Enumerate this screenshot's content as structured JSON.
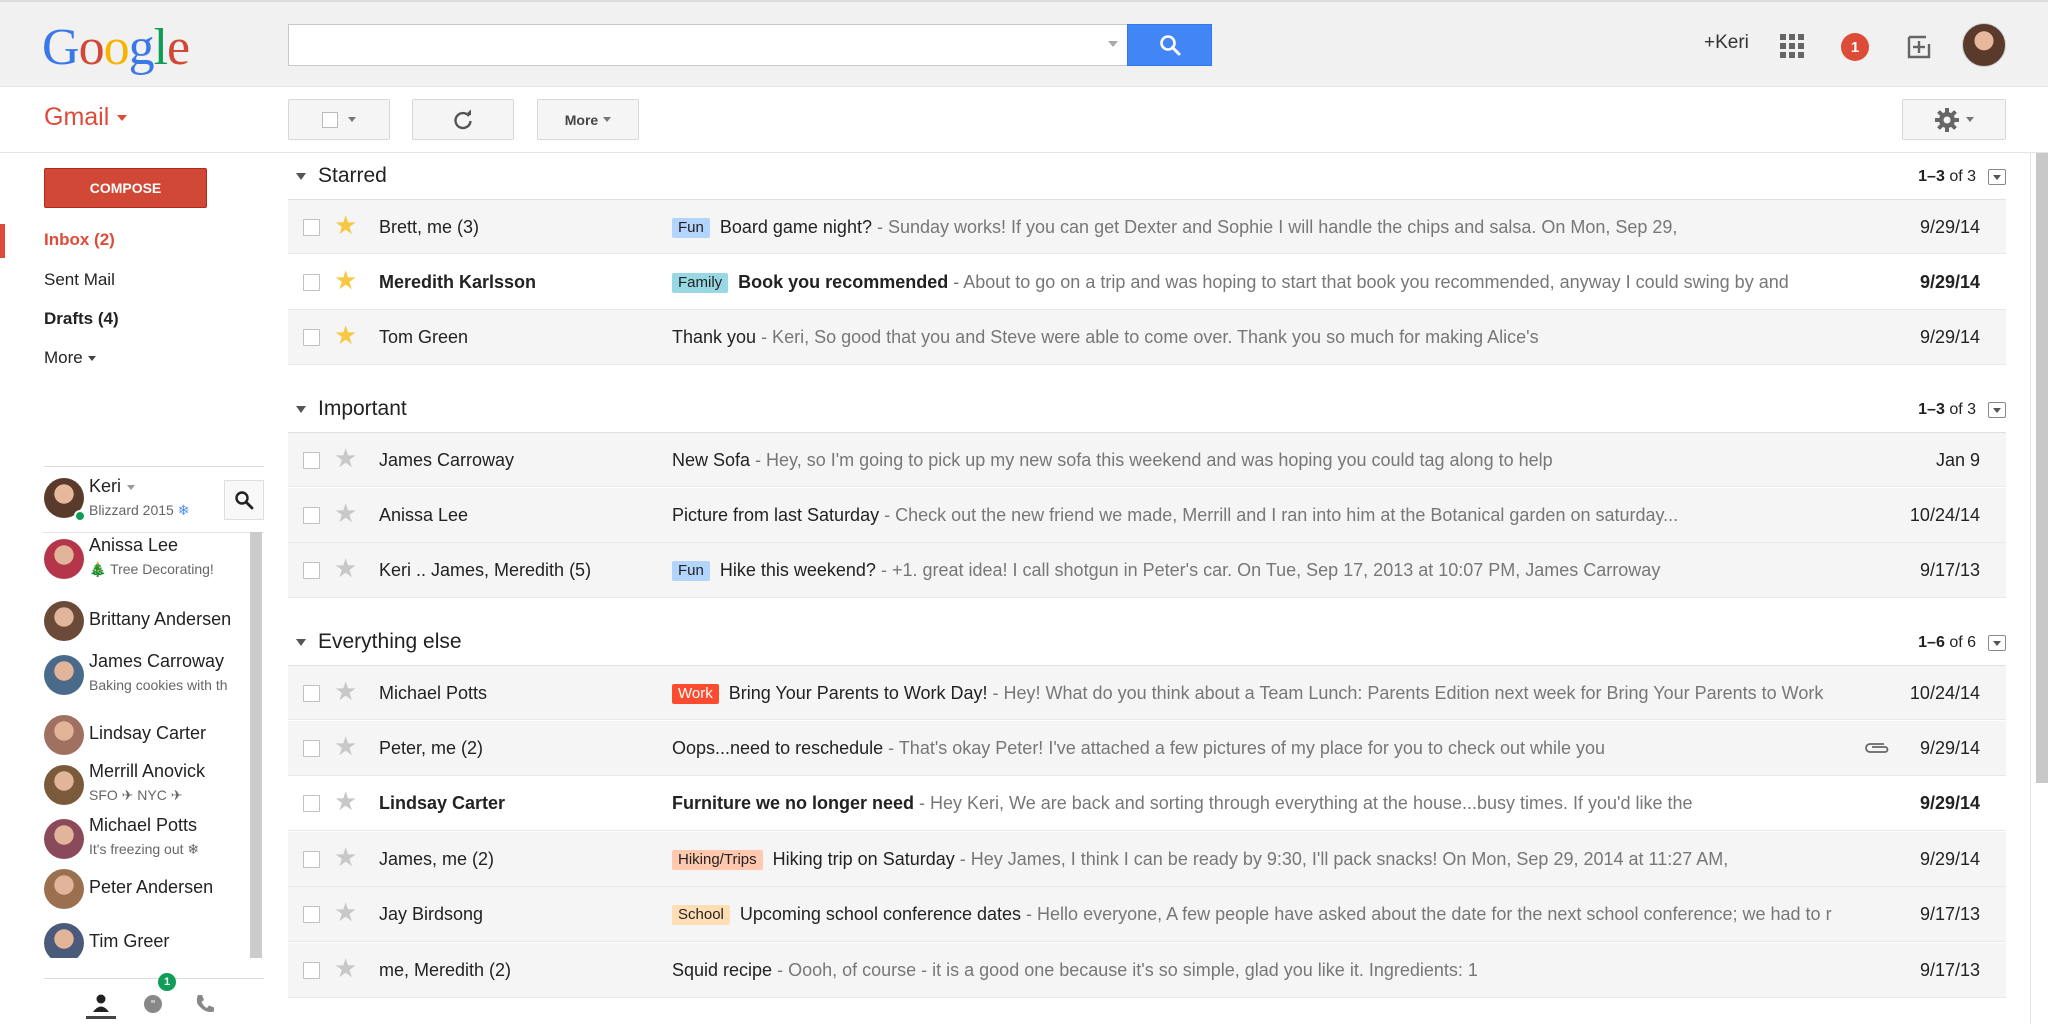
{
  "header": {
    "logo_letters": [
      {
        "char": "G",
        "color": "#3b78e7"
      },
      {
        "char": "o",
        "color": "#d14836"
      },
      {
        "char": "o",
        "color": "#f4b400"
      },
      {
        "char": "g",
        "color": "#3b78e7"
      },
      {
        "char": "l",
        "color": "#0f9d58"
      },
      {
        "char": "e",
        "color": "#d14836"
      }
    ],
    "search_value": "",
    "plus_user": "+Keri",
    "notification_count": "1"
  },
  "toolbar": {
    "app_label": "Gmail",
    "more_label": "More"
  },
  "nav": {
    "compose_label": "COMPOSE",
    "items": [
      {
        "label": "Inbox (2)"
      },
      {
        "label": "Sent Mail"
      },
      {
        "label": "Drafts (4)"
      },
      {
        "label": "More"
      }
    ]
  },
  "hangouts": {
    "self": {
      "name": "Keri",
      "status": "Blizzard 2015"
    },
    "contacts": [
      {
        "name": "Anissa Lee",
        "status": "🎄 Tree Decorating!"
      },
      {
        "name": "Brittany Andersen",
        "status": ""
      },
      {
        "name": "James Carroway",
        "status": "Baking cookies with th"
      },
      {
        "name": "Lindsay Carter",
        "status": ""
      },
      {
        "name": "Merrill Anovick",
        "status": "SFO ✈ NYC ✈"
      },
      {
        "name": "Michael Potts",
        "status": "It's freezing out ❄"
      },
      {
        "name": "Peter Andersen",
        "status": ""
      },
      {
        "name": "Tim Greer",
        "status": ""
      }
    ],
    "chat_badge": "1"
  },
  "sections": [
    {
      "title": "Starred",
      "count_range": "1–3",
      "count_of": "of 3",
      "rows": [
        {
          "sender": "Brett, me (3)",
          "label": "Fun",
          "label_bg": "#b3d4fc",
          "subject": "Board game night?",
          "snippet": " - Sunday works! If you can get Dexter and Sophie I will handle the chips and salsa. On Mon, Sep 29,",
          "date": "9/29/14",
          "starred": true,
          "unread": false
        },
        {
          "sender": "Meredith Karlsson",
          "label": "Family",
          "label_bg": "#98d7e4",
          "subject": "Book you recommended",
          "snippet": " - About to go on a trip and was hoping to start that book you recommended, anyway I could swing by and",
          "date": "9/29/14",
          "starred": true,
          "unread": true
        },
        {
          "sender": "Tom Green",
          "label": "",
          "label_bg": "",
          "subject": "Thank you",
          "snippet": " - Keri, So good that you and Steve were able to come over. Thank you so much for making Alice's",
          "date": "9/29/14",
          "starred": true,
          "unread": false
        }
      ]
    },
    {
      "title": "Important",
      "count_range": "1–3",
      "count_of": "of 3",
      "rows": [
        {
          "sender": "James Carroway",
          "label": "",
          "label_bg": "",
          "subject": "New Sofa",
          "snippet": " - Hey, so I'm going to pick up my new sofa this weekend and was hoping you could tag along to help",
          "date": "Jan 9",
          "starred": false,
          "unread": false
        },
        {
          "sender": "Anissa Lee",
          "label": "",
          "label_bg": "",
          "subject": "Picture from last Saturday",
          "snippet": " - Check out the new friend we made, Merrill and I ran into him at the Botanical garden on saturday...",
          "date": "10/24/14",
          "starred": false,
          "unread": false
        },
        {
          "sender": "Keri .. James, Meredith (5)",
          "label": "Fun",
          "label_bg": "#b3d4fc",
          "subject": "Hike this weekend?",
          "snippet": " - +1. great idea! I call shotgun in Peter's car. On Tue, Sep 17, 2013 at 10:07 PM, James Carroway",
          "date": "9/17/13",
          "starred": false,
          "unread": false
        }
      ]
    },
    {
      "title": "Everything else",
      "count_range": "1–6",
      "count_of": "of 6",
      "rows": [
        {
          "sender": "Michael Potts",
          "label": "Work",
          "label_bg": "#fb4c2f",
          "label_fg": "#fff",
          "subject": "Bring Your Parents to Work Day!",
          "snippet": " - Hey! What do you think about a Team Lunch: Parents Edition next week for Bring Your Parents to Work",
          "date": "10/24/14",
          "starred": false,
          "unread": false
        },
        {
          "sender": "Peter, me (2)",
          "label": "",
          "label_bg": "",
          "subject": "Oops...need to reschedule",
          "snippet": " - That's okay Peter! I've attached a few pictures of my place for you to check out while you",
          "date": "9/29/14",
          "starred": false,
          "unread": false,
          "attachment": true
        },
        {
          "sender": "Lindsay Carter",
          "label": "",
          "label_bg": "",
          "subject": "Furniture we no longer need",
          "snippet": " - Hey Keri, We are back and sorting through everything at the house...busy times. If you'd like the",
          "date": "9/29/14",
          "starred": false,
          "unread": true
        },
        {
          "sender": "James, me (2)",
          "label": "Hiking/Trips",
          "label_bg": "#ffc8af",
          "subject": "Hiking trip on Saturday",
          "snippet": " - Hey James, I think I can be ready by 9:30, I'll pack snacks! On Mon, Sep 29, 2014 at 11:27 AM,",
          "date": "9/29/14",
          "starred": false,
          "unread": false
        },
        {
          "sender": "Jay Birdsong",
          "label": "School",
          "label_bg": "#ffdeb5",
          "subject": "Upcoming school conference dates",
          "snippet": " - Hello everyone, A few people have asked about the date for the next school conference; we had to r",
          "date": "9/17/13",
          "starred": false,
          "unread": false
        },
        {
          "sender": "me, Meredith (2)",
          "label": "",
          "label_bg": "",
          "subject": "Squid recipe",
          "snippet": " - Oooh, of course - it is a good one because it's so simple, glad you like it. Ingredients: 1",
          "date": "9/17/13",
          "starred": false,
          "unread": false
        }
      ]
    }
  ]
}
